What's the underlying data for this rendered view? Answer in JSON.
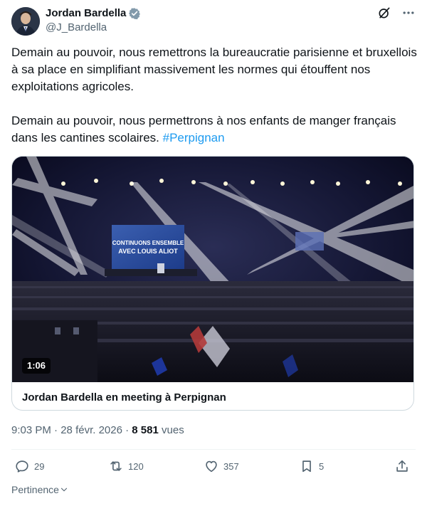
{
  "author": {
    "display_name": "Jordan Bardella",
    "handle": "@J_Bardella",
    "verified_badge": "verified-badge-icon"
  },
  "header_actions": {
    "grok_icon": "grok-icon",
    "more_icon": "more-icon"
  },
  "tweet": {
    "paragraph1": "Demain au pouvoir, nous remettrons la bureaucratie parisienne et bruxellois à sa place en simplifiant massivement les normes qui étouffent nos exploitations agricoles.",
    "paragraph2_text": "Demain au pouvoir, nous permettrons à nos enfants de manger français dans les cantines scolaires. ",
    "hashtag": "#Perpignan"
  },
  "media": {
    "duration": "1:06",
    "screen_line1": "CONTINUONS ENSEMBLE",
    "screen_line2": "AVEC LOUIS ALIOT",
    "title": "Jordan Bardella en meeting à Perpignan"
  },
  "meta": {
    "time": "9:03 PM",
    "separator": " · ",
    "date": "28 févr. 2026",
    "views_count": "8 581",
    "views_label": " vues"
  },
  "actions": {
    "replies": "29",
    "reposts": "120",
    "likes": "357",
    "bookmarks": "5"
  },
  "pertinence": {
    "label": "Pertinence"
  },
  "colors": {
    "accent": "#1d9bf0",
    "secondary_text": "#536471",
    "border": "#cfd9de"
  }
}
